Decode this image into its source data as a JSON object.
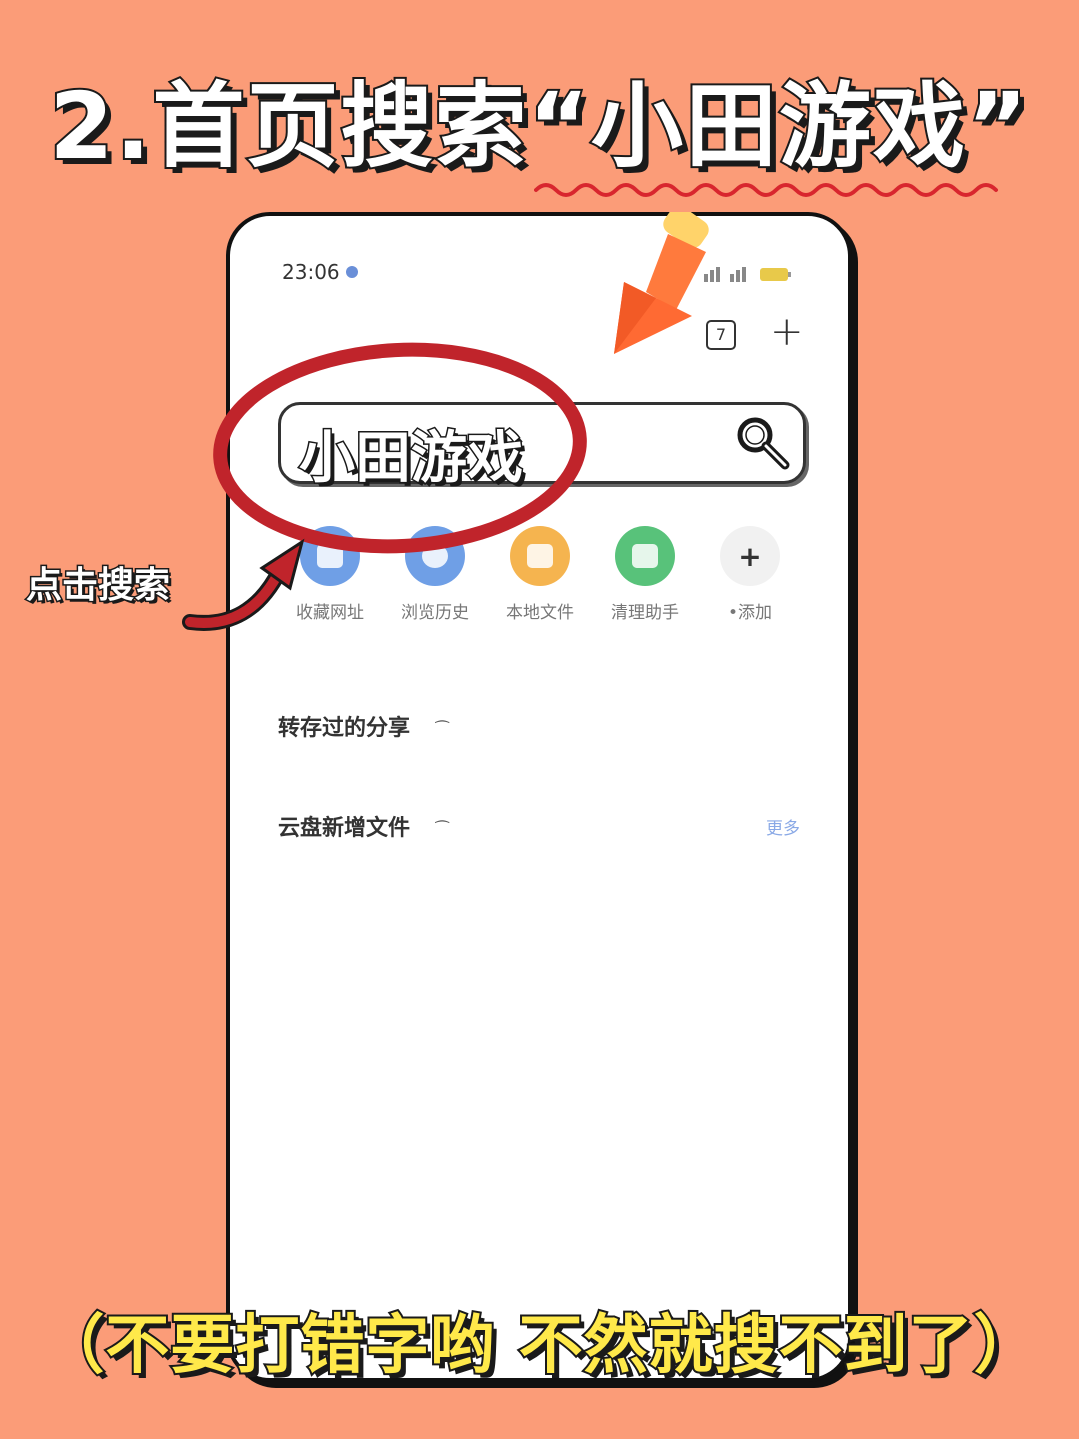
{
  "header": {
    "title": "2.首页搜索“小田游戏”"
  },
  "phone": {
    "status_time": "23:06",
    "tabs_count": "7",
    "plus_label": "+",
    "search": {
      "value": "小田游戏"
    },
    "quick_actions": [
      {
        "label": "收藏网址",
        "color": "#6F9FE6"
      },
      {
        "label": "浏览历史",
        "color": "#6F9FE6"
      },
      {
        "label": "本地文件",
        "color": "#F5B44F"
      },
      {
        "label": "清理助手",
        "color": "#58C27A"
      },
      {
        "label": "•添加",
        "color": "#F1F1F1",
        "icon": "+"
      }
    ],
    "sections": {
      "saved_shares": "转存过的分享",
      "new_files": "云盘新增文件",
      "more_link": "更多"
    }
  },
  "annotations": {
    "callout": "点击搜索",
    "bottom_note": "（不要打错字哟 不然就搜不到了）"
  },
  "colors": {
    "background": "#FB9C78",
    "highlight_circle": "#C0242B",
    "pointer_arrow": "#FF6A33",
    "bottom_note": "#FFE94A"
  }
}
